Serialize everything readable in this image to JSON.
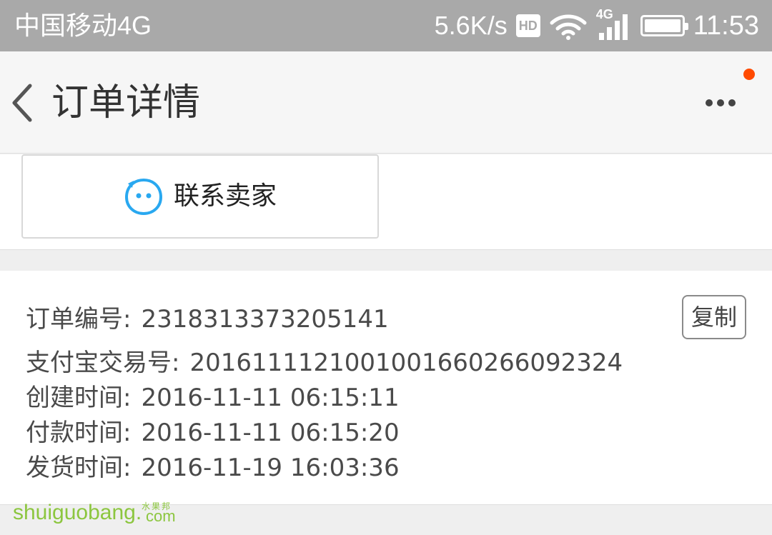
{
  "status_bar": {
    "carrier": "中国移动4G",
    "net_speed": "5.6K/s",
    "hd": "HD",
    "network": "4G",
    "time": "11:53"
  },
  "nav": {
    "title": "订单详情",
    "notify_color": "#ff4a00"
  },
  "contact": {
    "label": "联系卖家",
    "icon": "chat-face-icon",
    "icon_color": "#29a8f0"
  },
  "order": {
    "copy_label": "复制",
    "rows": [
      {
        "key": "订单编号:",
        "value": "2318313373205141"
      },
      {
        "key": "支付宝交易号:",
        "value": "2016111121001001660266092324"
      },
      {
        "key": "创建时间:",
        "value": "2016-11-11 06:15:11"
      },
      {
        "key": "付款时间:",
        "value": "2016-11-11 06:15:20"
      },
      {
        "key": "发货时间:",
        "value": "2016-11-19 16:03:36"
      }
    ]
  },
  "watermark": {
    "text": "shuiguobang",
    "domain": "com",
    "sub": "水果邦"
  }
}
